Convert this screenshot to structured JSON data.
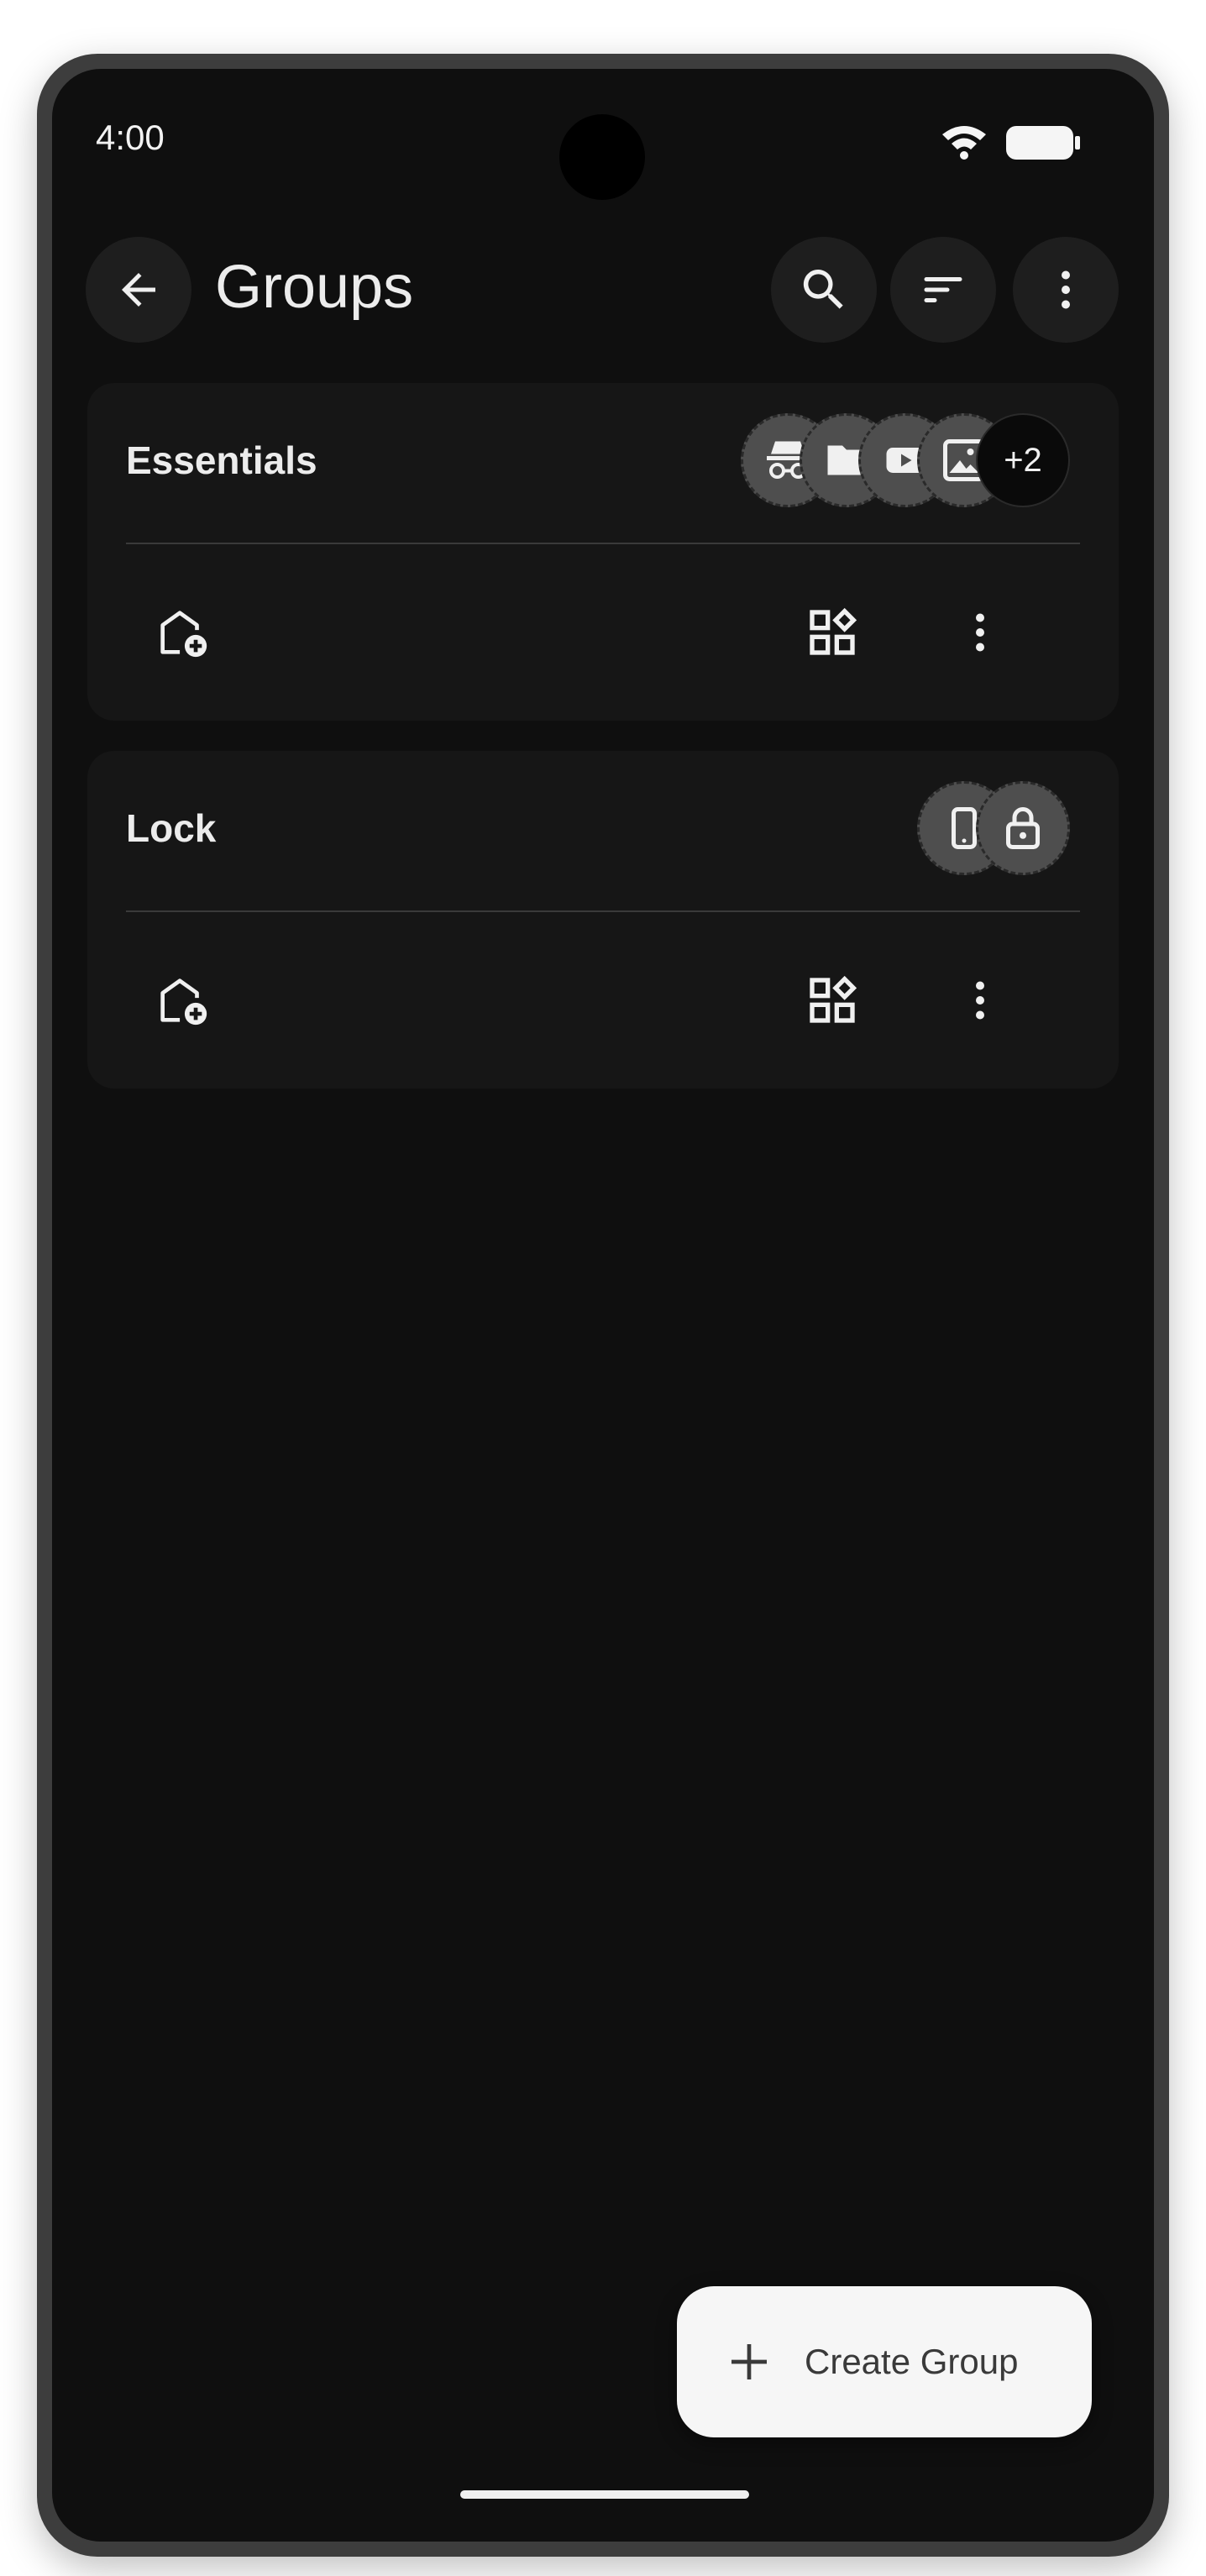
{
  "status_bar": {
    "time": "4:00",
    "icons": [
      "wifi-icon",
      "battery-icon"
    ]
  },
  "app_bar": {
    "title": "Groups",
    "back_icon": "arrow-back-icon",
    "actions": [
      "search-icon",
      "sort-icon",
      "more-vert-icon"
    ]
  },
  "groups": [
    {
      "name": "Essentials",
      "app_icons": [
        "incognito-icon",
        "folder-icon",
        "video-icon",
        "gallery-icon"
      ],
      "overflow_count": "+2",
      "actions": [
        "add-to-home-icon",
        "widgets-icon",
        "more-vert-icon"
      ]
    },
    {
      "name": "Lock",
      "app_icons": [
        "phone-icon",
        "lock-icon"
      ],
      "overflow_count": "",
      "actions": [
        "add-to-home-icon",
        "widgets-icon",
        "more-vert-icon"
      ]
    }
  ],
  "fab": {
    "label": "Create Group",
    "icon": "plus-icon"
  },
  "colors": {
    "background": "#0f0f0f",
    "card": "#161616",
    "button": "#1e1e1e",
    "fab": "#f6f6f6"
  }
}
